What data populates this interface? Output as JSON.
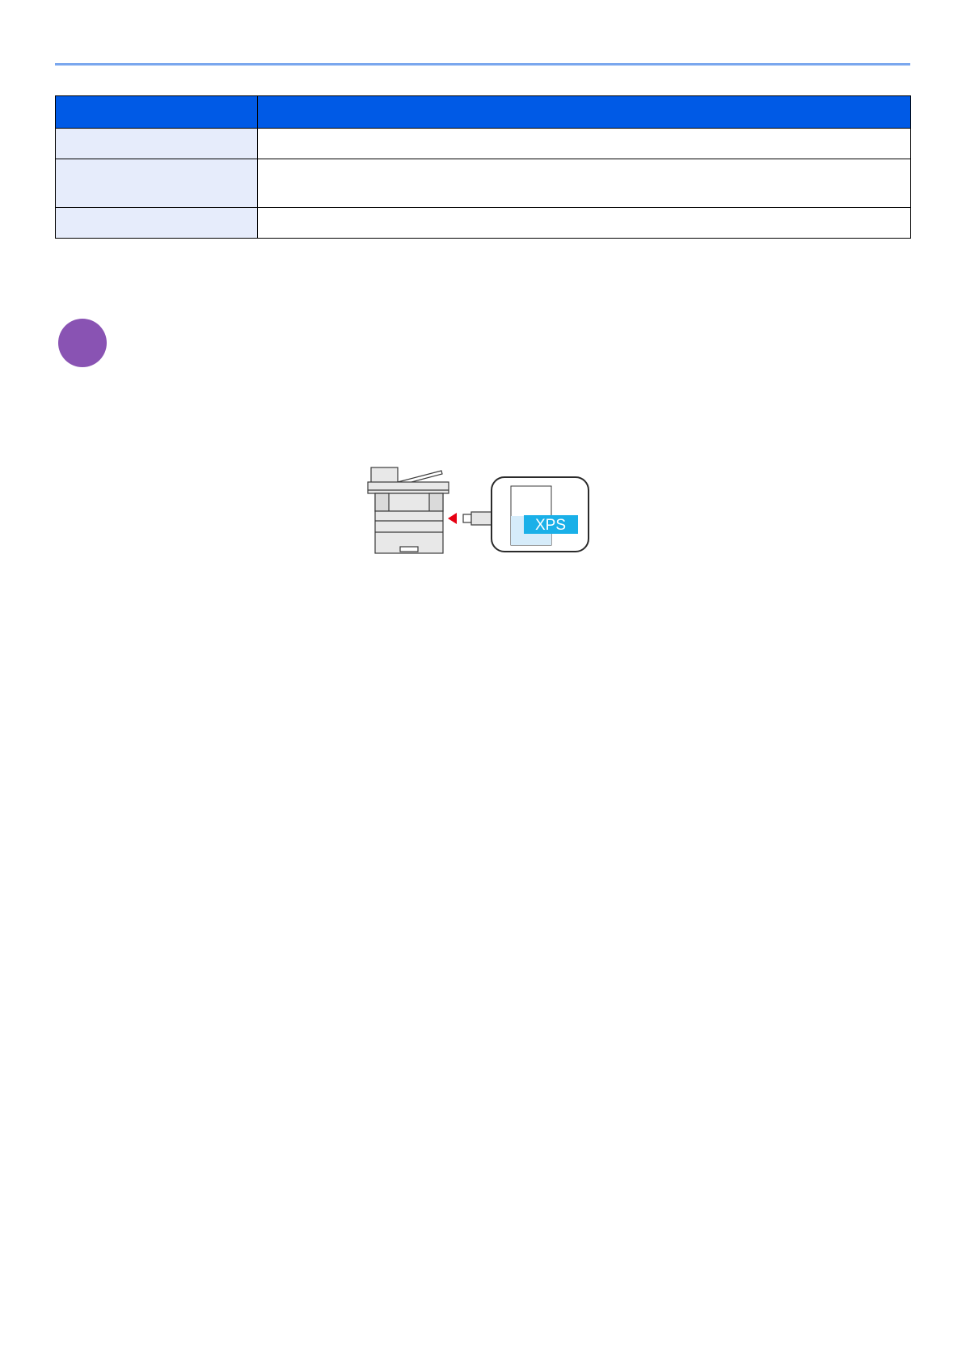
{
  "header": {
    "rule_color": "#7aa7ee"
  },
  "table": {
    "header_color": "#005ae6",
    "label_color": "#e6ecfb",
    "columns": [
      "",
      ""
    ],
    "rows": [
      {
        "label": "",
        "value": ""
      },
      {
        "label": "",
        "value": ""
      },
      {
        "label": "",
        "value": ""
      }
    ]
  },
  "step": {
    "number": "",
    "color": "#8953b3"
  },
  "illustration": {
    "file_label": "XPS",
    "file_label_color": "#1ab0e8",
    "arrow_color": "#e60012",
    "icons": [
      "printer-icon",
      "usb-plug-icon",
      "usb-memory-icon"
    ]
  }
}
